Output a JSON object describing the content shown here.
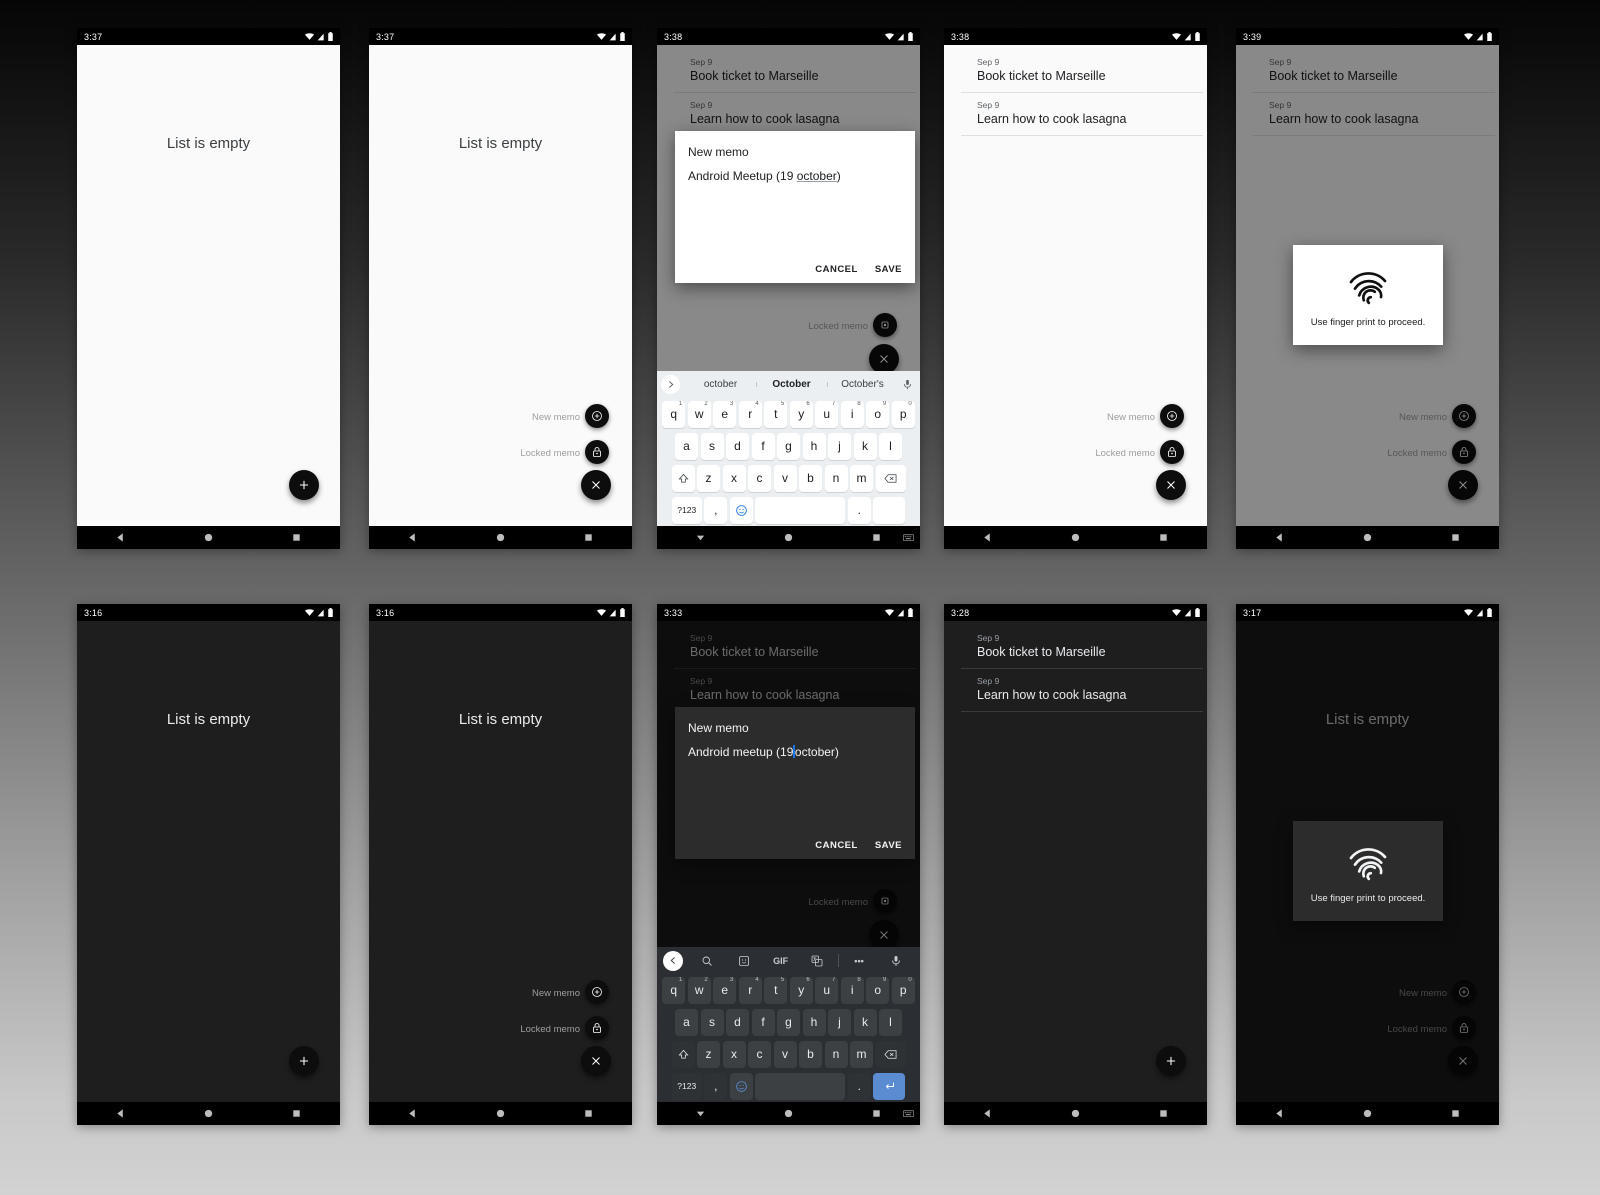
{
  "app": {
    "empty_text": "List is empty",
    "fab_labels": {
      "new_memo": "New memo",
      "locked_memo": "Locked memo"
    }
  },
  "memos": [
    {
      "date": "Sep 9",
      "title": "Book ticket to Marseille"
    },
    {
      "date": "Sep 9",
      "title": "Learn how to cook lasagna"
    }
  ],
  "dialog_light": {
    "title": "New memo",
    "text_before": "Android Meetup (19 ",
    "text_misspelled": "october",
    "text_after": ")",
    "cancel": "CANCEL",
    "save": "SAVE"
  },
  "dialog_dark": {
    "title": "New memo",
    "text_before": "Android meetup (19",
    "text_after": "october)",
    "cancel": "CANCEL",
    "save": "SAVE"
  },
  "fingerprint": {
    "text": "Use finger print to proceed."
  },
  "keyboard": {
    "suggestions": [
      "october",
      "October",
      "October's"
    ],
    "selected_suggestion": "October",
    "row1": [
      {
        "k": "q",
        "n": "1"
      },
      {
        "k": "w",
        "n": "2"
      },
      {
        "k": "e",
        "n": "3"
      },
      {
        "k": "r",
        "n": "4"
      },
      {
        "k": "t",
        "n": "5"
      },
      {
        "k": "y",
        "n": "6"
      },
      {
        "k": "u",
        "n": "7"
      },
      {
        "k": "i",
        "n": "8"
      },
      {
        "k": "o",
        "n": "9"
      },
      {
        "k": "p",
        "n": "0"
      }
    ],
    "row2": [
      "a",
      "s",
      "d",
      "f",
      "g",
      "h",
      "j",
      "k",
      "l"
    ],
    "row3": [
      "z",
      "x",
      "c",
      "v",
      "b",
      "n",
      "m"
    ],
    "symbols_key": "?123",
    "comma_key": ",",
    "period_key": ".",
    "gif_label": "GIF",
    "more_label": "•••"
  },
  "screens_light": [
    {
      "id": "light-empty",
      "time": "3:37"
    },
    {
      "id": "light-fab-open",
      "time": "3:37"
    },
    {
      "id": "light-dialog",
      "time": "3:38"
    },
    {
      "id": "light-list",
      "time": "3:38"
    },
    {
      "id": "light-fingerprint",
      "time": "3:39"
    }
  ],
  "screens_dark": [
    {
      "id": "dark-empty",
      "time": "3:16"
    },
    {
      "id": "dark-fab-open",
      "time": "3:16"
    },
    {
      "id": "dark-dialog",
      "time": "3:33"
    },
    {
      "id": "dark-list",
      "time": "3:28"
    },
    {
      "id": "dark-fingerprint",
      "time": "3:17"
    }
  ]
}
